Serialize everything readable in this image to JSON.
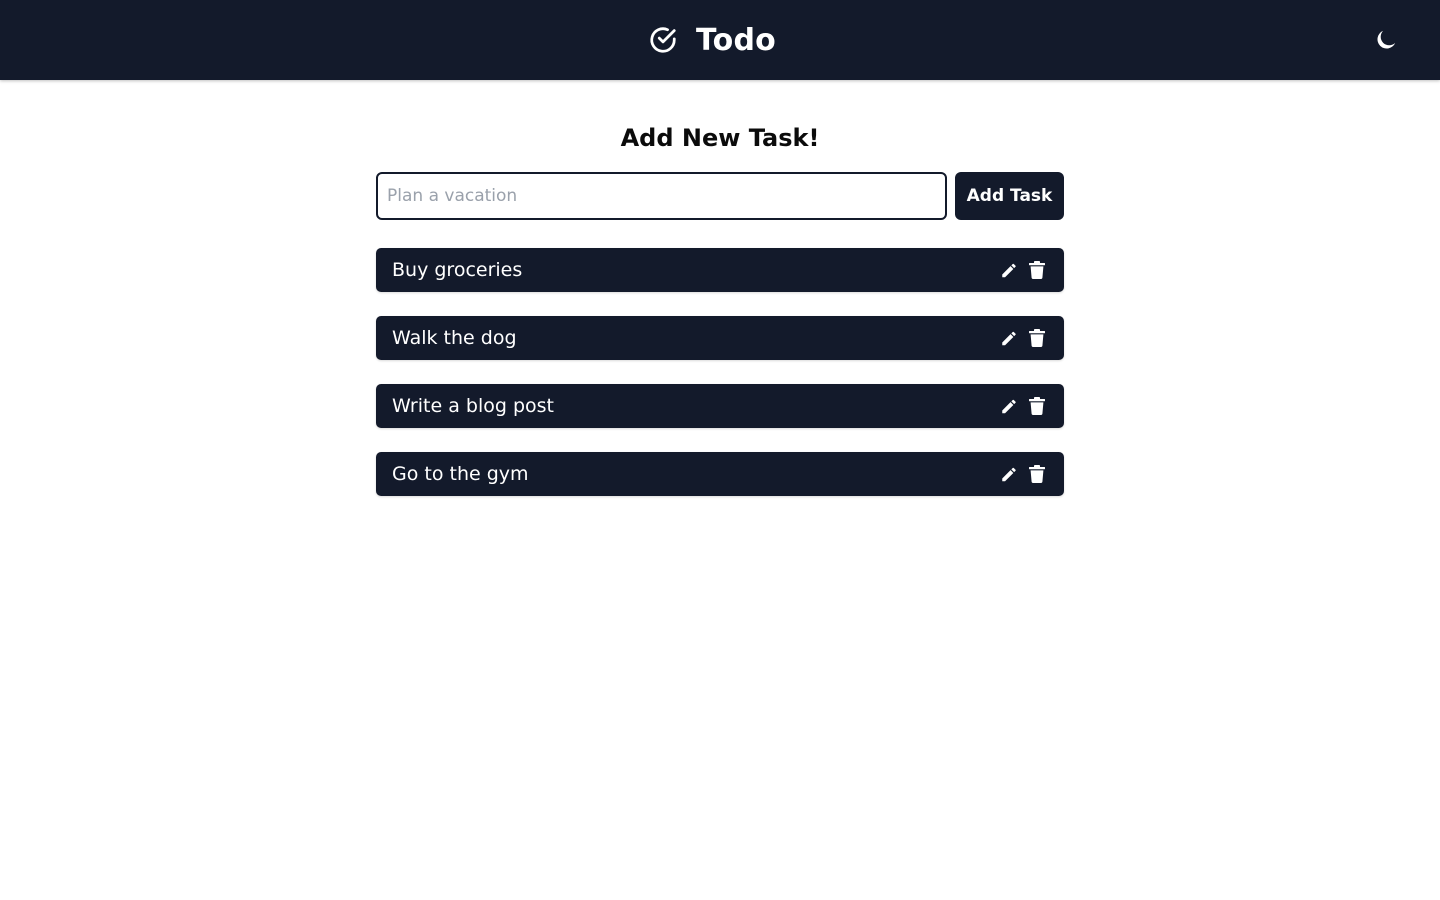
{
  "header": {
    "title": "Todo",
    "logo_icon": "check-circle-icon",
    "theme_icon": "moon-icon"
  },
  "add_task": {
    "heading": "Add New Task!",
    "input_value": "",
    "input_placeholder": "Plan a vacation",
    "button_label": "Add Task"
  },
  "tasks": [
    {
      "text": "Buy groceries",
      "edit_icon": "pencil-icon",
      "delete_icon": "trash-icon"
    },
    {
      "text": "Walk the dog",
      "edit_icon": "pencil-icon",
      "delete_icon": "trash-icon"
    },
    {
      "text": "Write a blog post",
      "edit_icon": "pencil-icon",
      "delete_icon": "trash-icon"
    },
    {
      "text": "Go to the gym",
      "edit_icon": "pencil-icon",
      "delete_icon": "trash-icon"
    }
  ],
  "colors": {
    "navbar": "#131a2b",
    "task_background": "#131a2b",
    "accent_text": "#ffffff",
    "page_background": "#ffffff"
  }
}
